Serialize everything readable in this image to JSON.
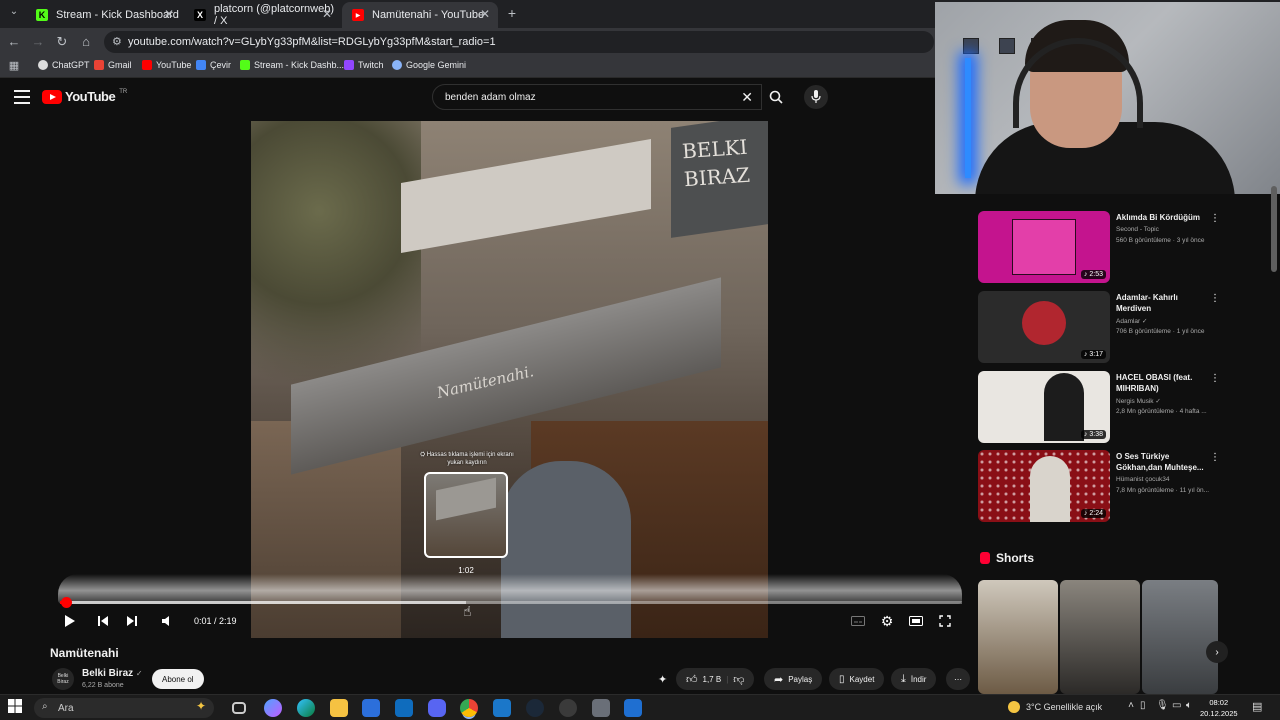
{
  "browser": {
    "tabs": [
      {
        "label": "Stream - Kick Dashboard",
        "favicon_color": "#53fc18",
        "favicon_letter": "K",
        "active": false
      },
      {
        "label": "platcorn (@platcornweb) / X",
        "favicon_color": "#000000",
        "favicon_letter": "X",
        "active": false
      },
      {
        "label": "Namütenahi - YouTube",
        "favicon_color": "#ff0000",
        "favicon_letter": "▶",
        "active": true
      }
    ],
    "new_tab": "+",
    "url": "youtube.com/watch?v=GLybYg33pfM&list=RDGLybYg33pfM&start_radio=1",
    "bookmarks": [
      {
        "label": "ChatGPT",
        "color": "#dddddd"
      },
      {
        "label": "Gmail",
        "color": "#ea4335"
      },
      {
        "label": "YouTube",
        "color": "#ff0000"
      },
      {
        "label": "Çevir",
        "color": "#4285f4"
      },
      {
        "label": "Stream - Kick Dashb...",
        "color": "#53fc18"
      },
      {
        "label": "Twitch",
        "color": "#9146ff"
      },
      {
        "label": "Google Gemini",
        "color": "#8ab4f8"
      }
    ]
  },
  "youtube": {
    "logo_word": "YouTube",
    "region": "TR",
    "search_value": "benden adam olmaz",
    "video": {
      "sign_line1": "BELKI",
      "sign_line2": "BIRAZ",
      "awning_text": "Namütenahi.",
      "preview_note": "⛭ Hassas tıklama işlemi için ekranı yukarı kaydırın",
      "preview_time": "1:02",
      "timecode": "0:01 / 2:19",
      "progress_fraction": 0.007,
      "buffer_fraction": 0.45
    },
    "title": "Namütenahi",
    "channel": {
      "name": "Belki Biraz",
      "subs": "6,22 B abone",
      "avatar_text": "Belki Biraz",
      "subscribe_label": "Abone ol"
    },
    "actions": {
      "likes": "1,7 B",
      "share": "Paylaş",
      "save": "Kaydet",
      "download": "İndir",
      "more": "⋯"
    },
    "recommendations": [
      {
        "title": "Aklımda Bi Kördüğüm",
        "channel": "Second - Topic",
        "meta": "560 B görüntüleme · 3 yıl önce",
        "duration": "2:53",
        "thumb_color": "#c4148e"
      },
      {
        "title": "Adamlar- Kahırlı Merdiven",
        "channel": "Adamlar",
        "meta": "706 B görüntüleme · 1 yıl önce",
        "duration": "3:17",
        "thumb_color": "#2b2b2b"
      },
      {
        "title": "HACEL OBASI (feat. MIHRIBAN)",
        "channel": "Nergis Musik",
        "meta": "2,8 Mn görüntüleme · 4 hafta ...",
        "duration": "3:38",
        "thumb_color": "#e9e6e1"
      },
      {
        "title": "O Ses Türkiye Gökhan,dan Muhteşe...",
        "channel": "Hümanist çocuk34",
        "meta": "7,8 Mn görüntüleme · 11 yıl ön...",
        "duration": "2:24",
        "thumb_color": "#8a0f16"
      }
    ],
    "shorts_label": "Shorts"
  },
  "taskbar": {
    "search_placeholder": "Ara",
    "weather": "3°C  Genellikle açık",
    "time": "08:02",
    "date": "20.12.2025"
  }
}
